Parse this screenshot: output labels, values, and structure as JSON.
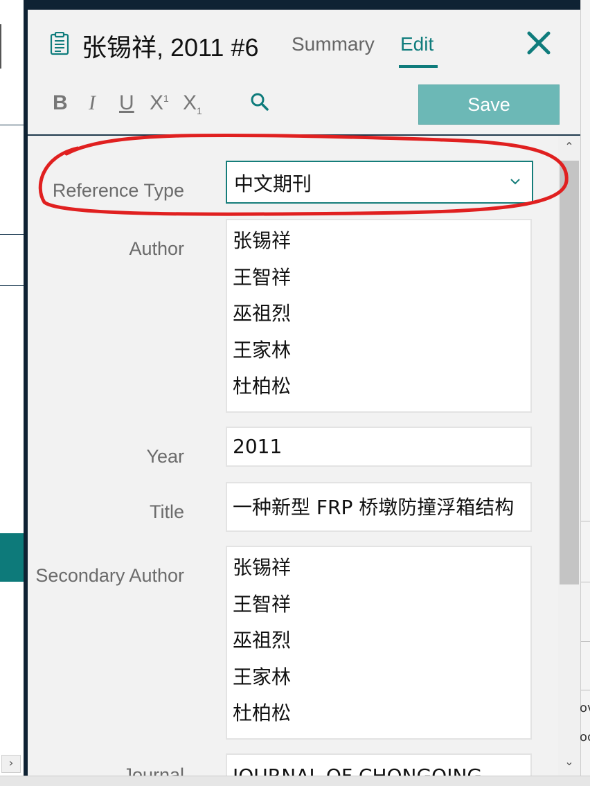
{
  "header": {
    "title": "张锡祥, 2011 #6",
    "tabs": [
      {
        "label": "Summary",
        "active": false
      },
      {
        "label": "Edit",
        "active": true
      }
    ],
    "close_icon": "close-icon"
  },
  "toolbar": {
    "bold": "B",
    "italic": "I",
    "underline": "U",
    "superscript": "X",
    "superscript_mark": "1",
    "subscript": "X",
    "subscript_mark": "1",
    "search_icon": "search-icon",
    "save_label": "Save"
  },
  "form": {
    "reference_type": {
      "label": "Reference Type",
      "value": "中文期刊"
    },
    "author": {
      "label": "Author",
      "values": [
        "张锡祥",
        "王智祥",
        "巫祖烈",
        "王家林",
        "杜柏松"
      ]
    },
    "year": {
      "label": "Year",
      "value": "2011"
    },
    "title": {
      "label": "Title",
      "value": "一种新型 FRP 桥墩防撞浮箱结构"
    },
    "secondary_author": {
      "label": "Secondary Author",
      "values": [
        "张锡祥",
        "王智祥",
        "巫祖烈",
        "王家林",
        "杜柏松"
      ]
    },
    "journal": {
      "label": "Journal",
      "value": "JOURNAL OF CHONGQING"
    }
  },
  "right_edge_fragments": [
    "ov",
    "oc"
  ],
  "colors": {
    "accent": "#0f7c7c",
    "save_button": "#6cb8b6",
    "panel_bg": "#f2f2f2",
    "dark_frame": "#0f2233",
    "annotation": "#e02020"
  }
}
